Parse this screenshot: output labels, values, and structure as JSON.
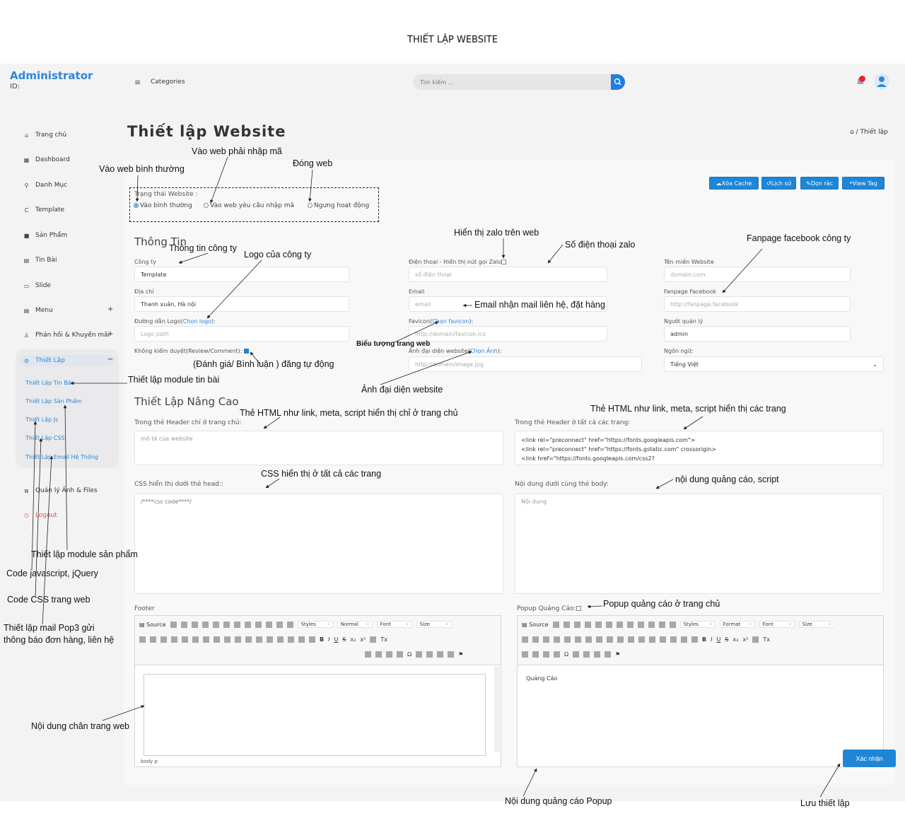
{
  "doc_title": "THIẾT LẬP  WEBSITE",
  "header": {
    "brand": "Administrator",
    "id_label": "ID:",
    "menu_icon": "≡",
    "categories": "Categories",
    "search_placeholder": "Tìm kiếm ...",
    "icons": [
      "search-icon",
      "bell-icon",
      "user-avatar-icon"
    ],
    "accent": "#1f86d6"
  },
  "sidebar": {
    "items": [
      {
        "label": "Trang chủ",
        "icon": "home-icon"
      },
      {
        "label": "Dashboard",
        "icon": "dashboard-icon"
      },
      {
        "label": "Danh Mục",
        "icon": "link-icon"
      },
      {
        "label": "Template",
        "icon": "template-icon"
      },
      {
        "label": "Sản Phẩm",
        "icon": "product-icon"
      },
      {
        "label": "Tin Bài",
        "icon": "news-icon"
      },
      {
        "label": "Slide",
        "icon": "slide-icon"
      },
      {
        "label": "Menu",
        "icon": "menu-icon",
        "plus": "+"
      },
      {
        "label": "Phản hồi & Khuyến mãi",
        "icon": "feedback-icon",
        "plus": "+"
      },
      {
        "label": "Thiết Lập",
        "icon": "gear-icon",
        "minus": "−"
      }
    ],
    "sub_items": [
      "Thiết Lập Tin Bài",
      "Thiết Lập Sản Phẩm",
      "Thiết Lập Js",
      "Thiết Lập CSS",
      "Thiết Lập Email Hệ Thống"
    ],
    "after": [
      {
        "label": "Quản lý Ảnh & Files",
        "icon": "files-icon"
      },
      {
        "label": "Logout",
        "icon": "logout-icon"
      }
    ]
  },
  "page": {
    "title": "Thiết lập Website",
    "breadcrumb": "/ Thiết lập",
    "toolbar": [
      "Xóa Cache",
      "Lịch sử",
      "Dọn rác",
      "View Tag"
    ]
  },
  "status": {
    "label": "Trạng thái Website :",
    "options": [
      "Vào bình thường",
      "Vào web yêu cầu nhập mã",
      "Ngưng hoạt động"
    ],
    "selected": 0
  },
  "info": {
    "section": "Thông Tin",
    "company_label": "Công ty",
    "company_value": "Template",
    "address_label": "Địa chỉ",
    "address_value": "Thanh xuân, Hà nội",
    "logo_label": "Đường dẫn Logo(",
    "logo_link": "Chọn logo",
    "logo_label_end": "):",
    "logo_placeholder": "Logo path",
    "review_label": "Không kiểm duyệt(Review/Comment):",
    "phone_label": "Điện thoại - Hiển thị nút gọi Zalo",
    "phone_placeholder": "số điện thoại",
    "email_label": "Email",
    "email_placeholder": "email",
    "favicon_label": "Favicon(",
    "favicon_link": "Chọn favicon",
    "favicon_label_end": "):",
    "favicon_placeholder": "http://domain/favicon.ico",
    "image_label": "Ảnh đại diện website(",
    "image_link": "Chọn Ảnh",
    "image_label_end": "):",
    "image_placeholder": "http://domain/image.jpg",
    "domain_label": "Tên miền Website",
    "domain_placeholder": "domain.com",
    "fanpage_label": "Fanpage Facebook",
    "fanpage_placeholder": "http://fanpage.facebook",
    "admin_label": "Người quản lý",
    "admin_value": "admin",
    "lang_label": "Ngôn ngữ:",
    "lang_value": "Tiếng Việt"
  },
  "advanced": {
    "section": "Thiết Lập Nâng Cao",
    "header_home_label": "Trong thẻ Header chỉ ở trang chủ:",
    "header_home_placeholder": "mô tả của website",
    "header_all_label": "Trong thẻ Header ở tất cả các trang:",
    "header_all_lines": [
      "<link rel=\"preconnect\" href=\"https://fonts.googleapis.com\">",
      "<link rel=\"preconnect\" href=\"https://fonts.gstatic.com\" crossorigin>",
      "<link href=\"https://fonts.googleapis.com/css2?"
    ],
    "css_label": "CSS hiển thị dưới thẻ head::",
    "css_value": "/****css code****/",
    "body_label": "Nội dung dưới cùng thẻ body:",
    "body_placeholder": "Nội dung",
    "footer_label": "Footer",
    "popup_label": "Popup Quảng Cáo:",
    "popup_content": "Quảng Cáo",
    "editor_status": "body  p",
    "editor_tools": {
      "source": "Source",
      "styles": "Styles",
      "normal": "Normal",
      "font": "Font",
      "size": "Size",
      "format": "Format"
    },
    "submit": "Xác nhận"
  },
  "annotations": {
    "normal": "Vào web bình thường",
    "code": "Vào web phải nhập mã",
    "close": "Đóng web",
    "zalo_show": "Hiển thị zalo trên web",
    "zalo_phone": "Số điện thoại zalo",
    "fanpage": "Fanpage facebook công ty",
    "company": "Thông tin công ty",
    "logo": "Logo của công ty",
    "email": "Email nhận mail liên hệ, đặt hàng",
    "favicon": "Biểu tượng trang web",
    "review": "(Đánh giá/ Bình luận ) đăng tự động",
    "image": "Ảnh đại diện website",
    "news": "Thiết lập module tin bài",
    "html_home": "Thẻ HTML như link, meta, script hiển thị chỉ ở trang chủ",
    "html_all": "Thẻ HTML như link, meta, script hiển thị các trang",
    "css_all": "CSS hiển thị ở tất cả các trang",
    "ads_script": "nội dung quảng cáo, script",
    "product": "Thiết lập module sản phẩm",
    "js": "Code javascript, jQuery",
    "css": "Code CSS trang web",
    "mail1": "Thiết lập mail Pop3 gửi",
    "mail2": "thông báo đơn hàng, liên hệ",
    "popup": "Popup quảng cáo ở trang chủ",
    "footer": "Nội dung chân trang web",
    "popup_content": "Nội dung quảng cáo Popup",
    "save": "Lưu thiết lập"
  }
}
